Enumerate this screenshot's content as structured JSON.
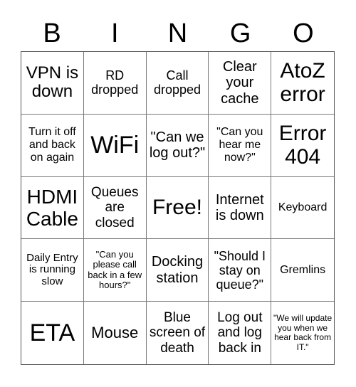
{
  "header": [
    "B",
    "I",
    "N",
    "G",
    "O"
  ],
  "cells": [
    "VPN is down",
    "RD dropped",
    "Call dropped",
    "Clear your cache",
    "AtoZ error",
    "Turn it off and back on again",
    "WiFi",
    "\"Can we log out?\"",
    "\"Can you hear me now?\"",
    "Error 404",
    "HDMI Cable",
    "Queues are closed",
    "Free!",
    "Internet is down",
    "Keyboard",
    "Daily Entry is running slow",
    "\"Can you please call back in a few hours?\"",
    "Docking station",
    "\"Should I stay on queue?\"",
    "Gremlins",
    "ETA",
    "Mouse",
    "Blue screen of death",
    "Log out and log back in",
    "\"We will update you when we hear back from IT.\""
  ]
}
